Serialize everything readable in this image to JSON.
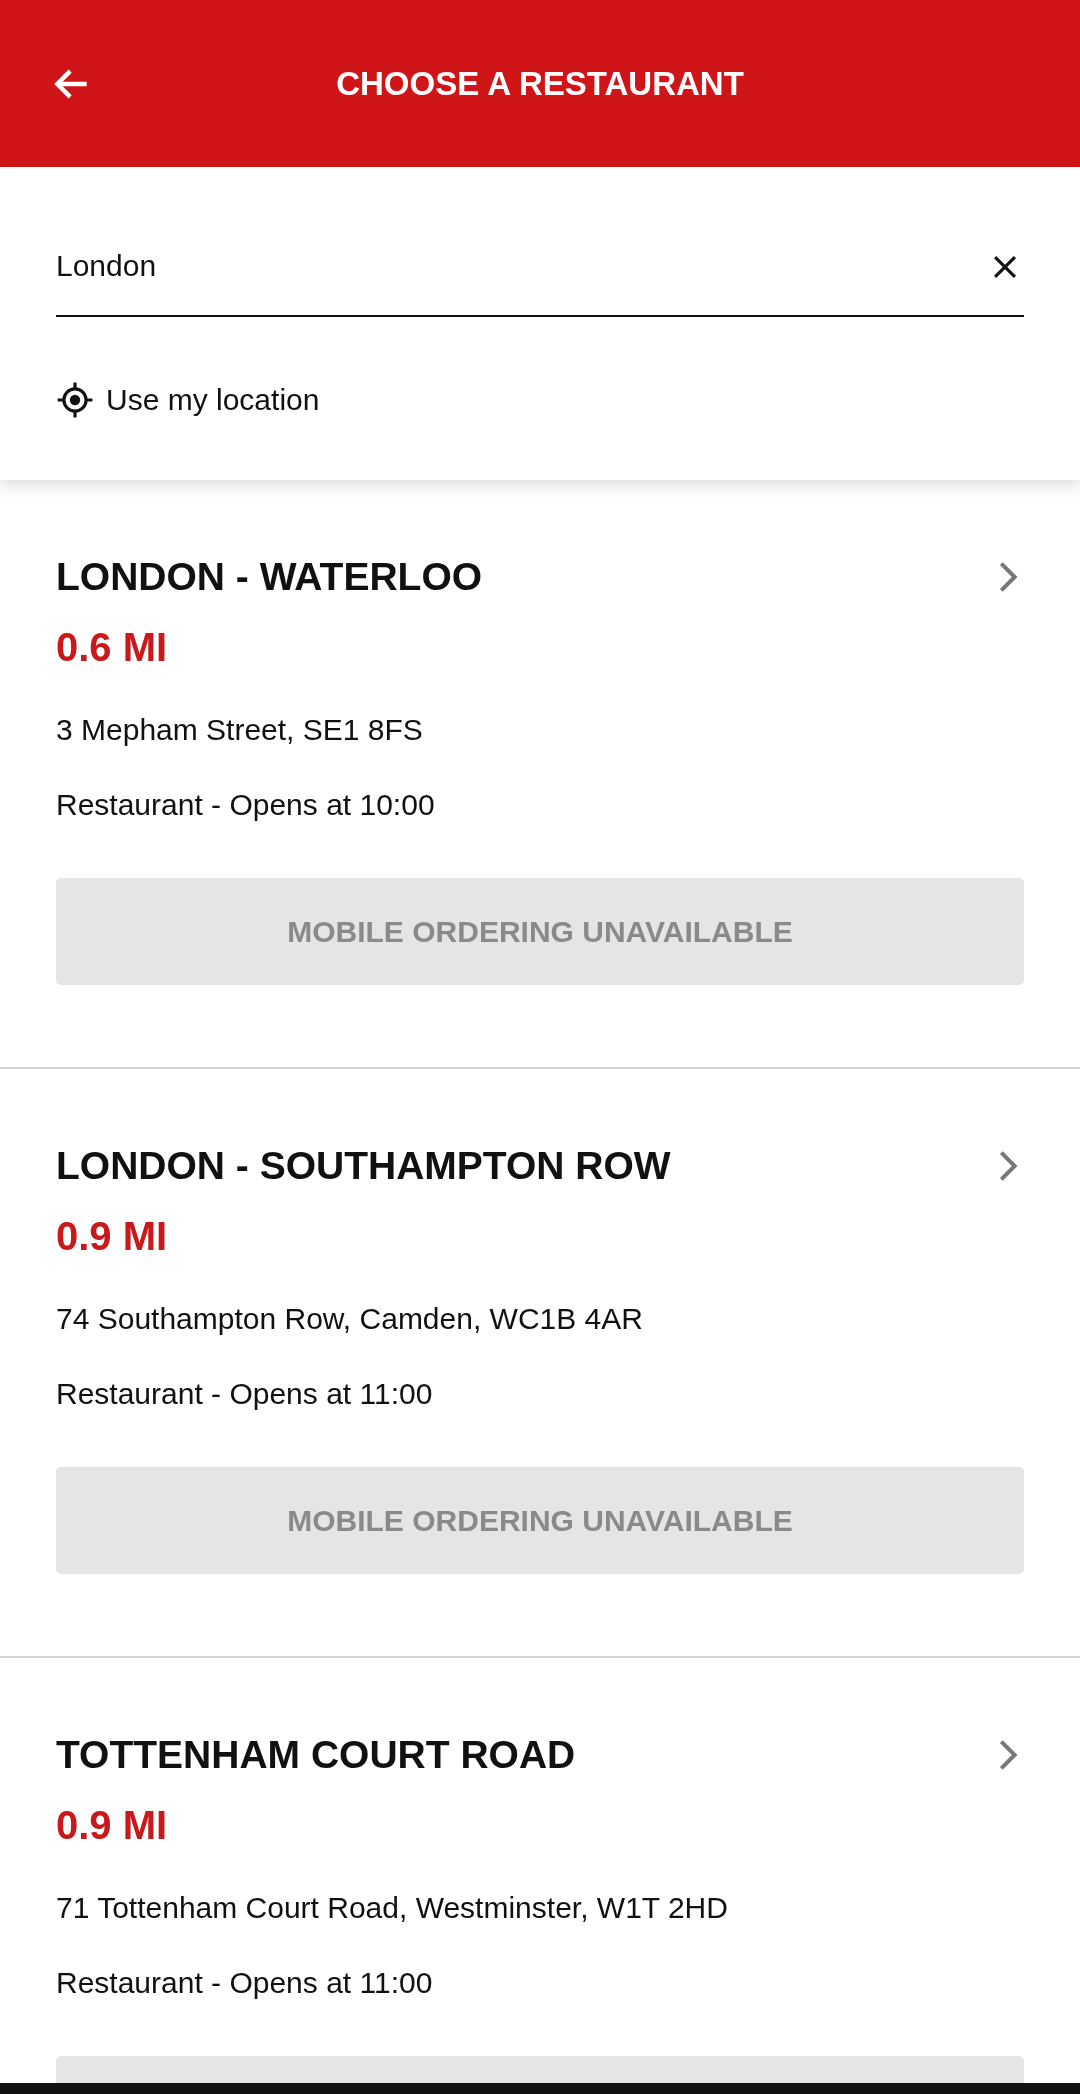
{
  "header": {
    "title": "CHOOSE A RESTAURANT"
  },
  "search": {
    "value": "London"
  },
  "location_link": "Use my location",
  "restaurants": [
    {
      "name": "LONDON - WATERLOO",
      "distance": "0.6 MI",
      "address": "3 Mepham Street, SE1 8FS",
      "hours": "Restaurant - Opens at 10:00",
      "ordering": {
        "label": "MOBILE ORDERING UNAVAILABLE",
        "available": false
      }
    },
    {
      "name": "LONDON - SOUTHAMPTON ROW",
      "distance": "0.9 MI",
      "address": "74 Southampton Row, Camden, WC1B 4AR",
      "hours": "Restaurant - Opens at 11:00",
      "ordering": {
        "label": "MOBILE ORDERING UNAVAILABLE",
        "available": false
      }
    },
    {
      "name": "TOTTENHAM COURT ROAD",
      "distance": "0.9 MI",
      "address": "71 Tottenham Court Road, Westminster, W1T 2HD",
      "hours": "Restaurant - Opens at 11:00",
      "ordering": {
        "available": false
      }
    }
  ]
}
